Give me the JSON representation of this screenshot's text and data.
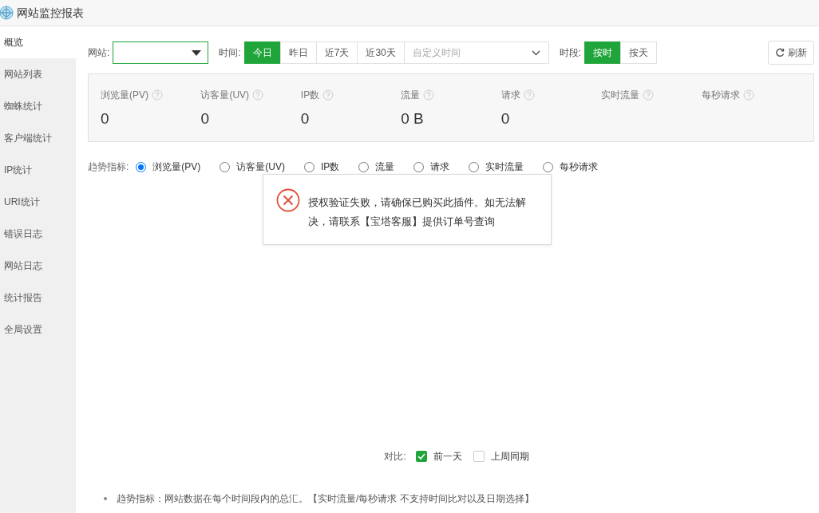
{
  "window": {
    "title": "网站监控报表"
  },
  "sidebar": {
    "items": [
      {
        "label": "概览",
        "selected": true
      },
      {
        "label": "网站列表",
        "selected": false
      },
      {
        "label": "蜘蛛统计",
        "selected": false
      },
      {
        "label": "客户端统计",
        "selected": false
      },
      {
        "label": "IP统计",
        "selected": false
      },
      {
        "label": "URI统计",
        "selected": false
      },
      {
        "label": "错误日志",
        "selected": false
      },
      {
        "label": "网站日志",
        "selected": false
      },
      {
        "label": "统计报告",
        "selected": false
      },
      {
        "label": "全局设置",
        "selected": false
      }
    ]
  },
  "toolbar": {
    "site_label": "网站:",
    "time_label": "时间:",
    "time_options": [
      {
        "label": "今日",
        "selected": true
      },
      {
        "label": "昨日",
        "selected": false
      },
      {
        "label": "近7天",
        "selected": false
      },
      {
        "label": "近30天",
        "selected": false
      }
    ],
    "custom_time": {
      "placeholder": "自定义时间"
    },
    "period_label": "时段:",
    "period_options": [
      {
        "label": "按时",
        "selected": true
      },
      {
        "label": "按天",
        "selected": false
      }
    ],
    "refresh": "刷新"
  },
  "stats": [
    {
      "label": "浏览量(PV)",
      "value": "0"
    },
    {
      "label": "访客量(UV)",
      "value": "0"
    },
    {
      "label": "IP数",
      "value": "0"
    },
    {
      "label": "流量",
      "value": "0 B"
    },
    {
      "label": "请求",
      "value": "0"
    },
    {
      "label": "实时流量"
    },
    {
      "label": "每秒请求"
    }
  ],
  "trend": {
    "label": "趋势指标:",
    "options": [
      {
        "label": "浏览量(PV)",
        "selected": true
      },
      {
        "label": "访客量(UV)",
        "selected": false
      },
      {
        "label": "IP数",
        "selected": false
      },
      {
        "label": "流量",
        "selected": false
      },
      {
        "label": "请求",
        "selected": false
      },
      {
        "label": "实时流量",
        "selected": false
      },
      {
        "label": "每秒请求",
        "selected": false
      }
    ]
  },
  "compare": {
    "label": "对比:",
    "options": [
      {
        "label": "前一天",
        "checked": true
      },
      {
        "label": "上周同期",
        "checked": false
      }
    ]
  },
  "note": "趋势指标：网站数据在每个时间段内的总汇。【实时流量/每秒请求 不支持时间比对以及日期选择】",
  "error_dialog": {
    "message": "授权验证失败，请确保已购买此插件。如无法解决，请联系【宝塔客服】提供订单号查询"
  }
}
